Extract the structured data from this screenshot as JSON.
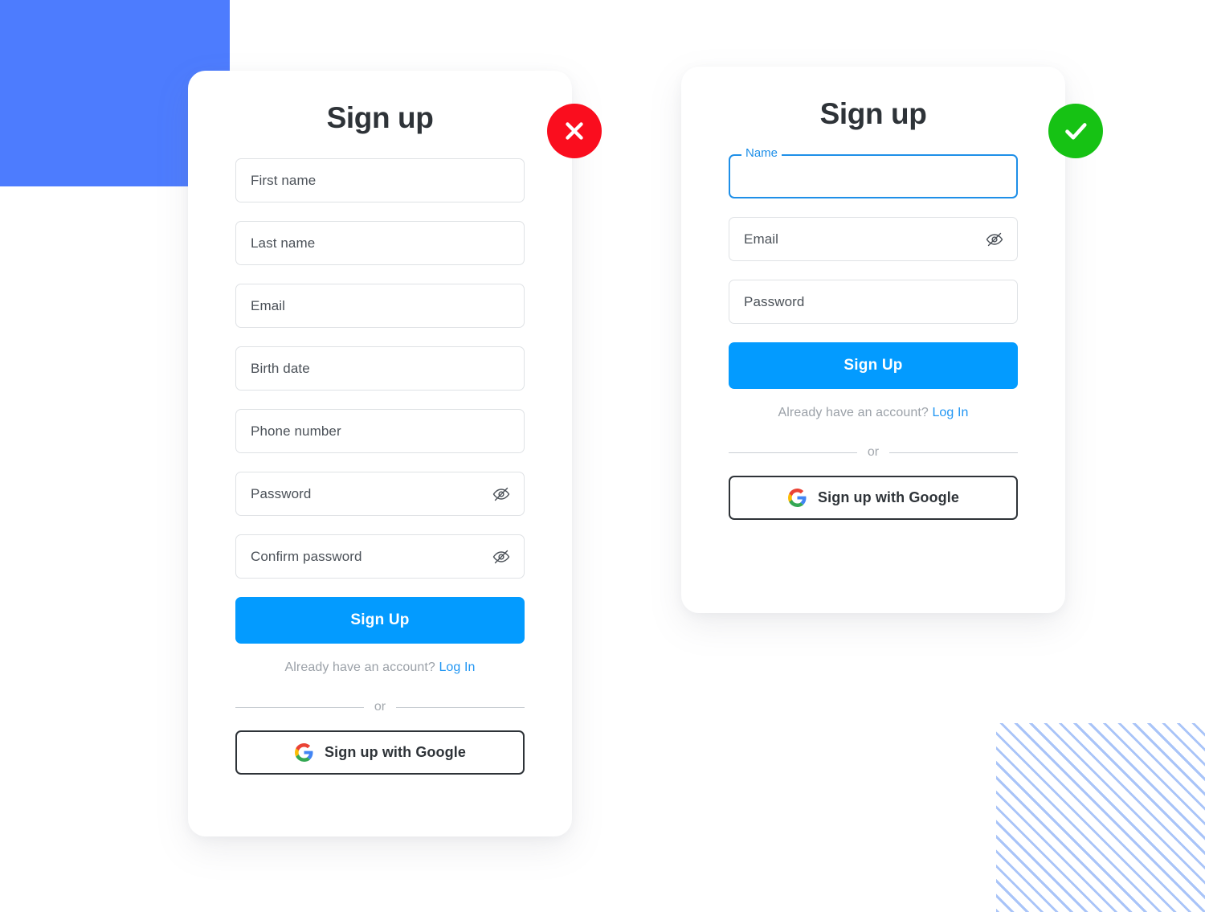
{
  "decor": {
    "blue_square_color": "#4d7cfe",
    "stripes_color": "#a9c4f8"
  },
  "colors": {
    "primary_blue": "#039bff",
    "link_blue": "#2196f3",
    "focus_blue": "#1e8fe8",
    "error_red": "#fa0d1e",
    "success_green": "#16c214",
    "text_dark": "#2e3338",
    "text_muted": "#9ba1a8",
    "border_grey": "#dfe2e5"
  },
  "left_card": {
    "title": "Sign up",
    "badge": {
      "type": "error",
      "icon": "close-icon"
    },
    "fields": [
      {
        "name": "first-name",
        "label": "First name",
        "has_eye": false
      },
      {
        "name": "last-name",
        "label": "Last name",
        "has_eye": false
      },
      {
        "name": "email",
        "label": "Email",
        "has_eye": false
      },
      {
        "name": "birth-date",
        "label": "Birth date",
        "has_eye": false
      },
      {
        "name": "phone-number",
        "label": "Phone number",
        "has_eye": false
      },
      {
        "name": "password",
        "label": "Password",
        "has_eye": true
      },
      {
        "name": "confirm-password",
        "label": "Confirm password",
        "has_eye": true
      }
    ],
    "submit_label": "Sign Up",
    "helper_text": "Already have an account?",
    "login_link": "Log In",
    "divider_label": "or",
    "google_label": "Sign up with Google"
  },
  "right_card": {
    "title": "Sign up",
    "badge": {
      "type": "success",
      "icon": "check-icon"
    },
    "focused_field": {
      "name": "name",
      "floating_label": "Name",
      "value": ""
    },
    "fields": [
      {
        "name": "email",
        "label": "Email",
        "has_eye": true
      },
      {
        "name": "password",
        "label": "Password",
        "has_eye": false
      }
    ],
    "submit_label": "Sign Up",
    "helper_text": "Already have an account?",
    "login_link": "Log In",
    "divider_label": "or",
    "google_label": "Sign up with Google"
  }
}
